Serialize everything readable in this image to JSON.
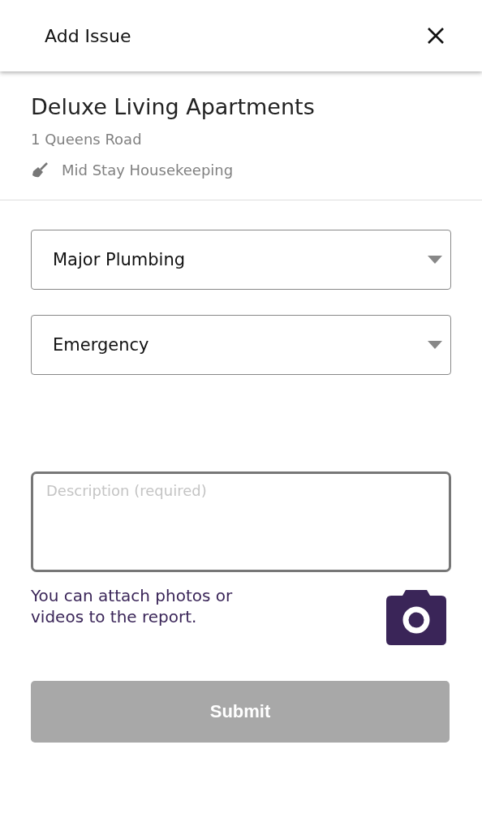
{
  "header": {
    "title": "Add Issue"
  },
  "property": {
    "name": "Deluxe Living Apartments",
    "address": "1  Queens Road",
    "service": "Mid Stay Housekeeping"
  },
  "dropdowns": [
    {
      "value": "Major Plumbing"
    },
    {
      "value": "Emergency"
    }
  ],
  "description": {
    "placeholder": "Description (required)"
  },
  "attach_hint": "You can attach photos or videos to the report.",
  "submit": {
    "label": "Submit",
    "disabled": true
  }
}
